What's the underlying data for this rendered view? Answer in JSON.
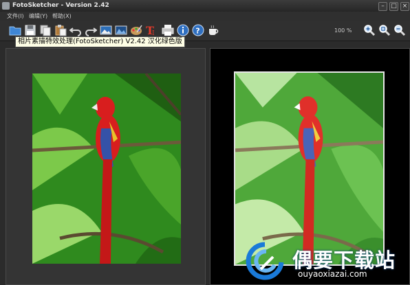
{
  "window": {
    "title": "FotoSketcher - Version 2.42",
    "minimize": "–",
    "maximize": "□",
    "close": "×"
  },
  "menu": {
    "items": [
      "文件(I)",
      "编辑(Y)",
      "帮助(X)"
    ]
  },
  "toolbar": {
    "icons": [
      "open-folder-icon",
      "save-icon",
      "copy-icon",
      "paste-icon",
      "undo-icon",
      "redo-icon",
      "image-icon",
      "landscape-icon",
      "palette-icon",
      "text-icon",
      "print-icon",
      "info-icon",
      "help-icon",
      "coffee-icon"
    ],
    "zoom_label": "100 %",
    "zoom_icons": [
      "zoom-in-icon",
      "zoom-fit-icon",
      "zoom-out-icon"
    ]
  },
  "tooltip": {
    "text": "相片素描特效处理(FotoSketcher) V2.42 汉化绿色版"
  },
  "watermark": {
    "title": "偶要下载站",
    "url": "ouyaoxiazai.com"
  },
  "colors": {
    "app_bg": "#2b2b2b",
    "titlebar": "#262626",
    "tooltip_bg": "#ffffe6",
    "parrot_red": "#d81e1e",
    "foliage_green": "#2f8a1e"
  }
}
